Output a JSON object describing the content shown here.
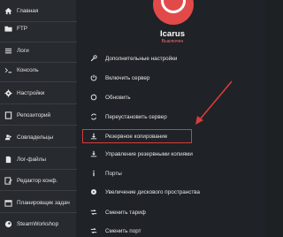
{
  "sidebar": {
    "items": [
      {
        "label": "Главная",
        "icon": "home-icon"
      },
      {
        "label": "FTP",
        "icon": "folder-icon"
      },
      {
        "label": "Логи",
        "icon": "list-icon"
      },
      {
        "label": "Консоль",
        "icon": "terminal-icon"
      },
      {
        "label": "Настройки",
        "icon": "gear-icon"
      },
      {
        "label": "Репозиторий",
        "icon": "repository-icon"
      },
      {
        "label": "Совладельцы",
        "icon": "users-icon"
      },
      {
        "label": "Лог-файлы",
        "icon": "file-icon"
      },
      {
        "label": "Редактор конф.",
        "icon": "edit-icon"
      },
      {
        "label": "Планировщик задач",
        "icon": "calendar-icon"
      },
      {
        "label": "SteamWorkshop",
        "icon": "steam-icon"
      }
    ]
  },
  "server": {
    "name": "Icarus",
    "status": "Выключен",
    "status_color": "#f06a6a",
    "brand_color": "#e24a4a"
  },
  "actions": [
    {
      "label": "Дополнительные настройки",
      "icon": "wrench-icon"
    },
    {
      "label": "Включить сервер",
      "icon": "power-icon"
    },
    {
      "label": "Обновить",
      "icon": "refresh-icon"
    },
    {
      "label": "Переустановить сервер",
      "icon": "reinstall-icon"
    },
    {
      "label": "Резервное копирование",
      "icon": "download-icon"
    },
    {
      "label": "Управление резервными копиями",
      "icon": "backup-manage-icon"
    },
    {
      "label": "Порты",
      "icon": "info-icon"
    },
    {
      "label": "Увеличение дискового пространства",
      "icon": "disk-icon"
    },
    {
      "label": "Сменить тариф",
      "icon": "swap-icon"
    },
    {
      "label": "Сменить порт",
      "icon": "swap-port-icon"
    }
  ],
  "highlight_color": "#d83b3b"
}
